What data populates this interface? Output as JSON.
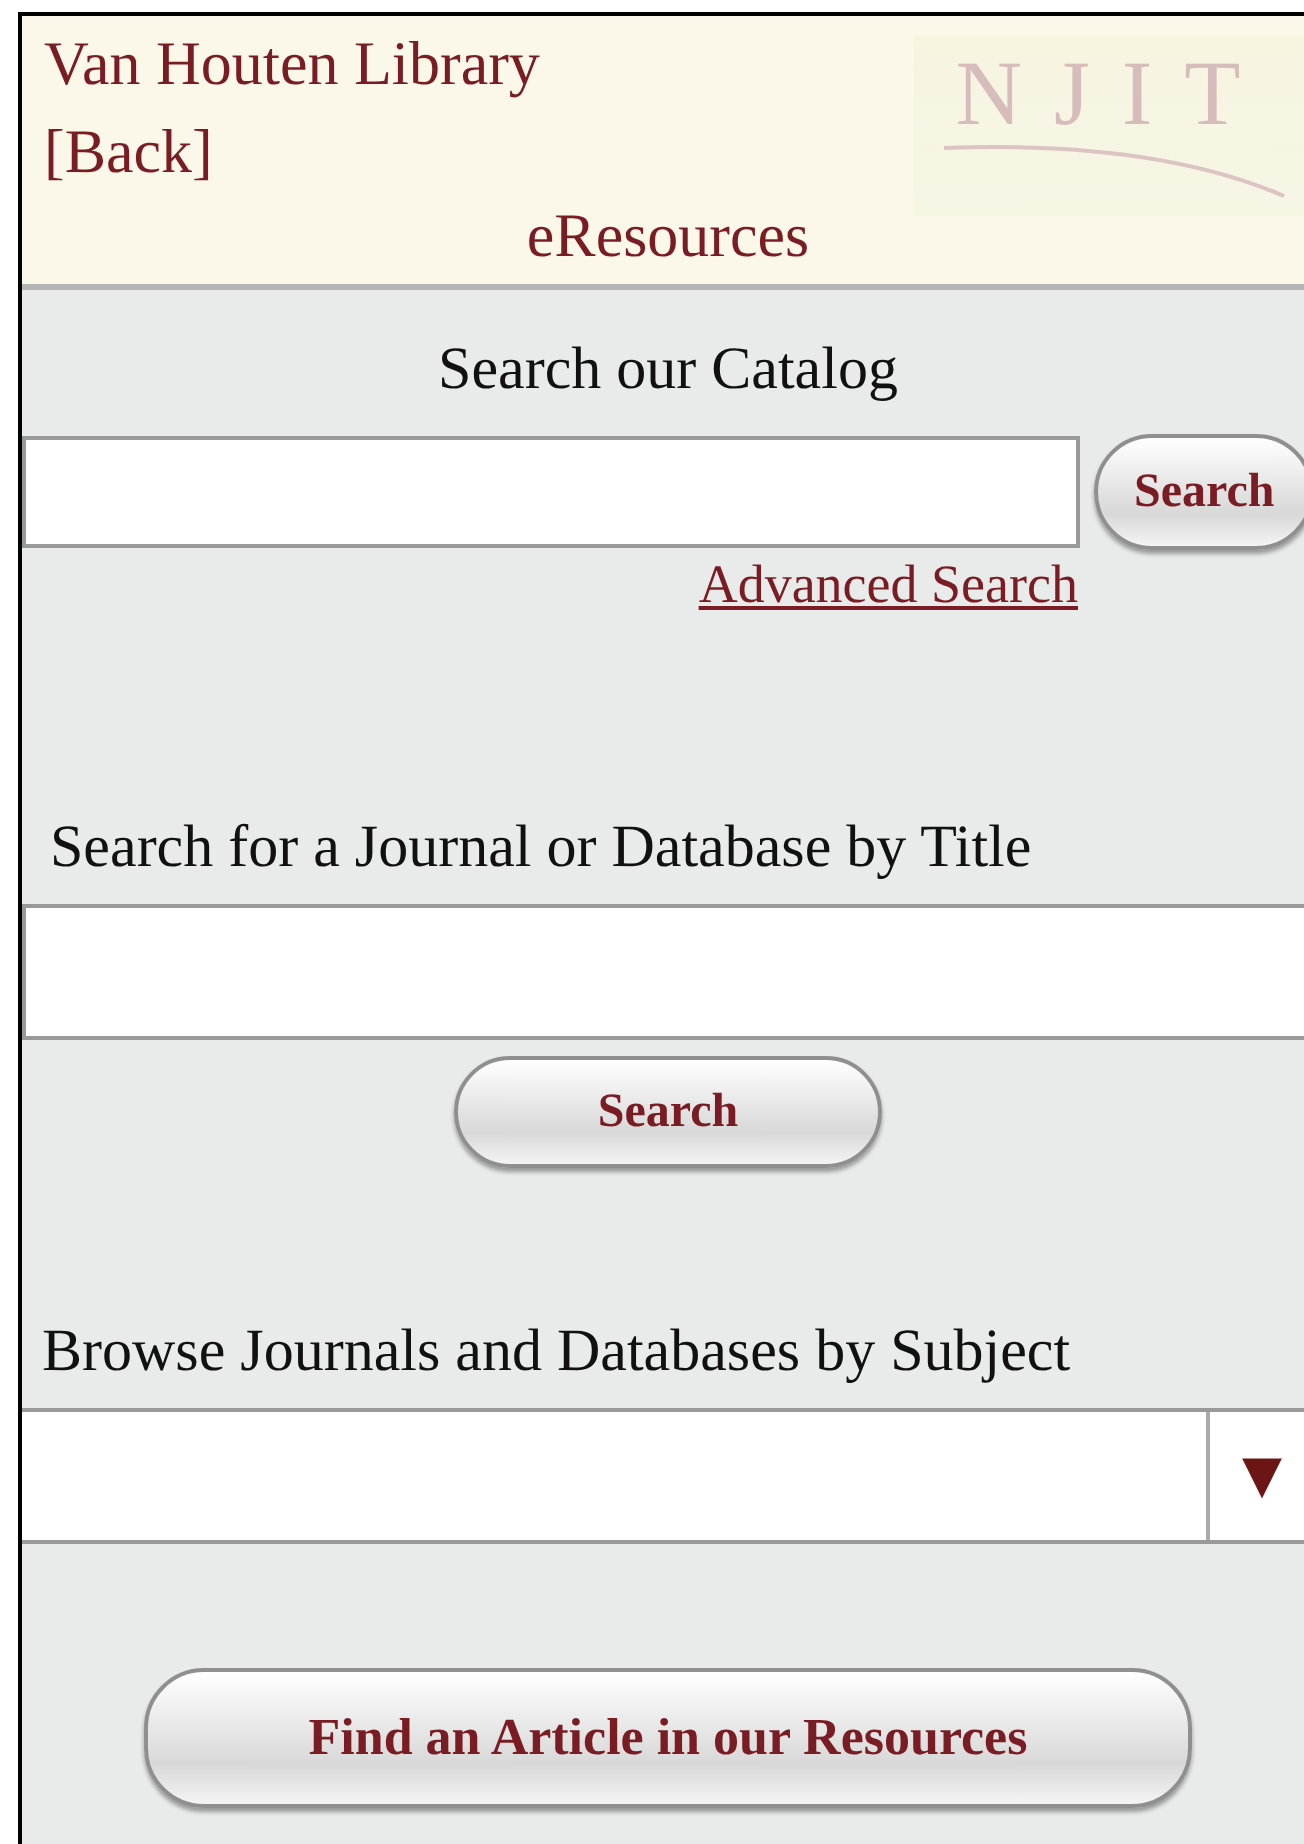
{
  "header": {
    "title": "Van Houten Library",
    "back_link": "[Back]",
    "logo_text": "NJIT",
    "section": "eResources"
  },
  "catalog": {
    "heading": "Search our Catalog",
    "button": "Search",
    "advanced_link": "Advanced Search"
  },
  "journal": {
    "heading": "Search for a Journal or Database by Title",
    "button": "Search"
  },
  "browse": {
    "heading": "Browse Journals and Databases by Subject",
    "arrow": "▼"
  },
  "article_button": "Find an Article in our Resources"
}
